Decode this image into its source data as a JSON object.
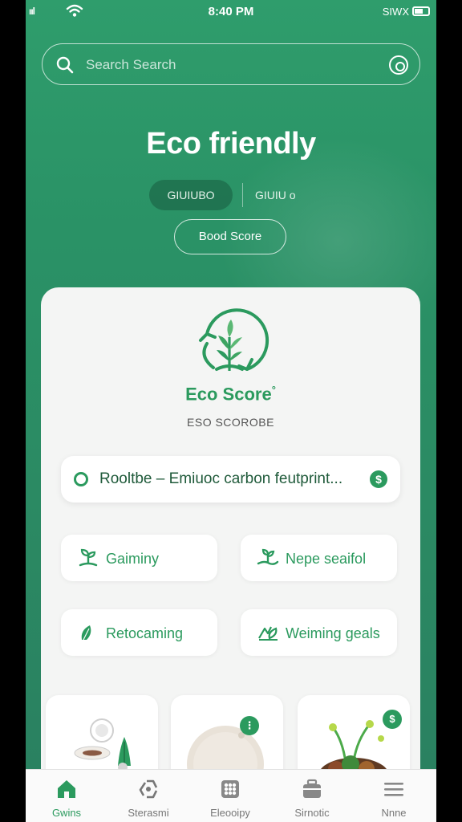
{
  "status_bar": {
    "signal": "ııl",
    "time": "8:40 PM",
    "carrier": "SIWX"
  },
  "search": {
    "placeholder": "Search Search"
  },
  "hero": {
    "title": "Eco friendly",
    "pill_left": "GIUIUBO",
    "pill_right": "GIUIU o",
    "button": "Bood Score"
  },
  "eco_card": {
    "title": "Eco Score",
    "title_mark": "°",
    "subtitle": "ESO SCOROBE",
    "banner_text": "Rooltbe – Emiuoc carbon feutprint...",
    "banner_badge": "$"
  },
  "tiles": [
    {
      "label": "Gaiminy",
      "icon": "sprout-icon"
    },
    {
      "label": "Nepe seaifol",
      "icon": "seedling-hand-icon"
    },
    {
      "label": "Retocaming",
      "icon": "leaf-icon"
    },
    {
      "label": "Weiming geals",
      "icon": "goal-leaf-icon"
    }
  ],
  "products": [
    {
      "name": "product-bowl"
    },
    {
      "name": "product-plate",
      "badge": "⋮"
    },
    {
      "name": "product-salad",
      "badge": "$"
    }
  ],
  "tabbar": {
    "items": [
      {
        "label": "Gwins",
        "icon": "home-icon",
        "active": true
      },
      {
        "label": "Sterasmi",
        "icon": "recycle-icon",
        "active": false
      },
      {
        "label": "Eleooipy",
        "icon": "grid-icon",
        "active": false
      },
      {
        "label": "Sirnotic",
        "icon": "briefcase-icon",
        "active": false
      },
      {
        "label": "Nnne",
        "icon": "menu-icon",
        "active": false
      }
    ]
  },
  "colors": {
    "brand_green": "#2b9a5e",
    "header_green": "#2f9d6c",
    "card_bg": "#f4f5f4"
  }
}
